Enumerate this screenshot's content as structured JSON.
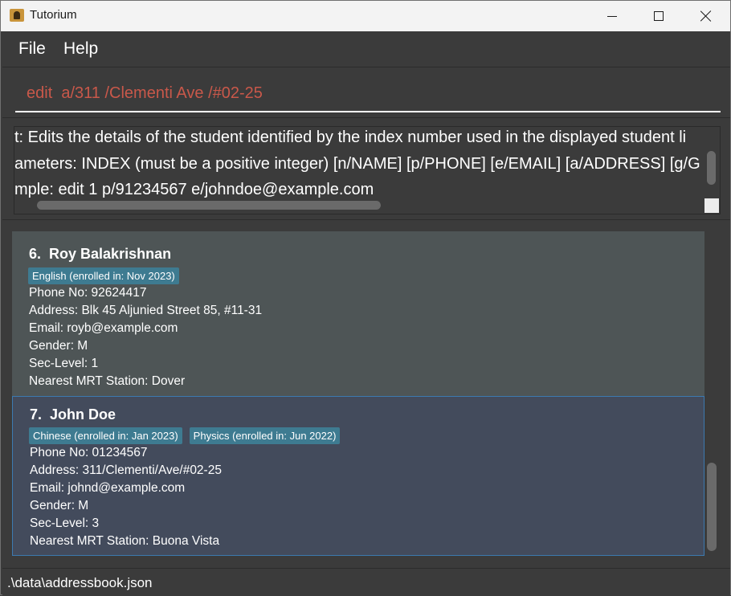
{
  "window": {
    "title": "Tutorium",
    "icon": "tutorium-app-icon"
  },
  "menu": {
    "items": [
      "File",
      "Help"
    ]
  },
  "command_box": {
    "value": "edit  a/311 /Clementi Ave /#02-25"
  },
  "result_display": {
    "lines": [
      "t: Edits the details of the student identified by the index number used in the displayed student li",
      "ameters: INDEX (must be a positive integer) [n/NAME] [p/PHONE] [e/EMAIL] [a/ADDRESS] [g/G",
      "mple: edit 1 p/91234567 e/johndoe@example.com"
    ]
  },
  "students": [
    {
      "index": "6.",
      "name": "Roy Balakrishnan",
      "tags": [
        "English (enrolled in: Nov 2023)"
      ],
      "phone": "Phone No: 92624417",
      "address": "Address: Blk 45 Aljunied Street 85, #11-31",
      "email": "Email: royb@example.com",
      "gender": "Gender: M",
      "sec_level": "Sec-Level: 1",
      "mrt": "Nearest MRT Station: Dover"
    },
    {
      "index": "7.",
      "name": "John Doe",
      "tags": [
        "Chinese (enrolled in: Jan 2023)",
        "Physics (enrolled in: Jun 2022)"
      ],
      "phone": "Phone No: 01234567",
      "address": "Address: 311/Clementi/Ave/#02-25",
      "email": "Email: johnd@example.com",
      "gender": "Gender: M",
      "sec_level": "Sec-Level: 3",
      "mrt": "Nearest MRT Station: Buona Vista"
    }
  ],
  "status_bar": {
    "path": ".\\data\\addressbook.json"
  },
  "colors": {
    "background": "#3b3b3b",
    "card": "#4e5556",
    "selected_card": "#434b5c",
    "tag": "#3e7b91",
    "command_text": "#c9584a"
  }
}
